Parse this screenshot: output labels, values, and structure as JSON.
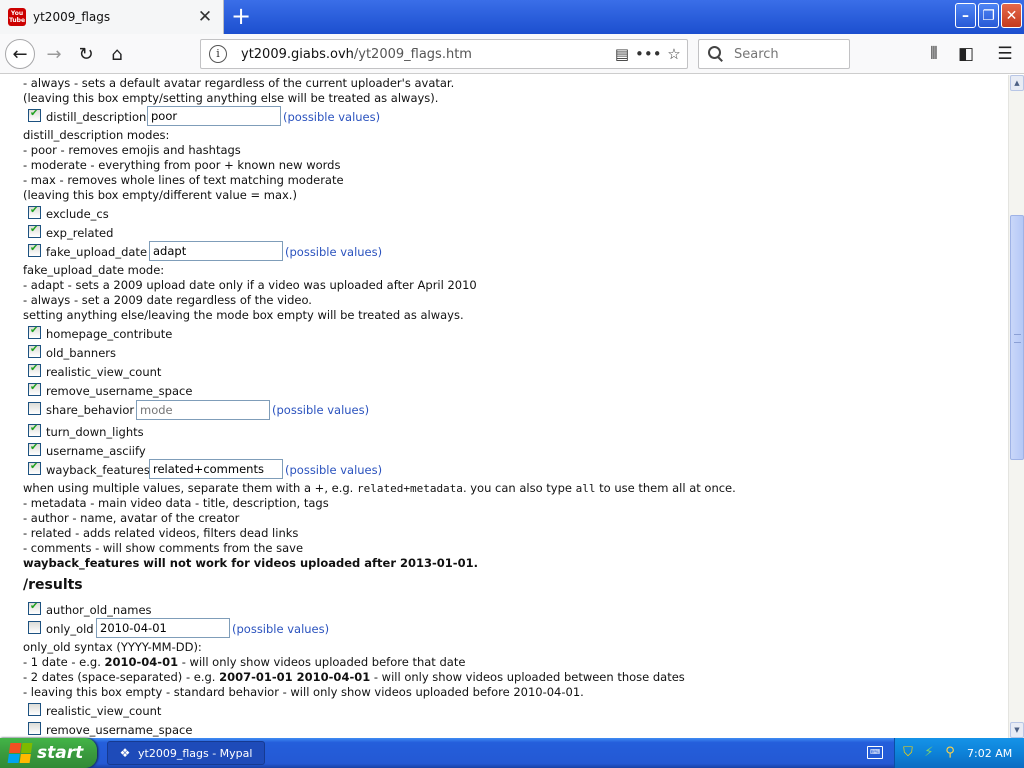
{
  "browser": {
    "tab_title": "yt2009_flags",
    "tab_favicon_text": "You Tube",
    "url_host": "yt2009.giabs.ovh",
    "url_path": "/yt2009_flags.htm",
    "search_placeholder": "Search"
  },
  "colors": {
    "link": "#2a52be",
    "check": "#21a121",
    "taskbar": "#245edb",
    "start": "#3a9b3e"
  },
  "content": {
    "avatar_line1": "- always - sets a default avatar regardless of the current uploader's avatar.",
    "avatar_line2": "(leaving this box empty/setting anything else will be treated as always).",
    "flags": {
      "distill_description": {
        "label": "distill_description",
        "checked": true,
        "value": "poor",
        "link": "(possible values)"
      },
      "exclude_cs": {
        "label": "exclude_cs",
        "checked": true
      },
      "exp_related": {
        "label": "exp_related",
        "checked": true
      },
      "fake_upload_date": {
        "label": "fake_upload_date",
        "checked": true,
        "value": "adapt",
        "link": "(possible values)"
      },
      "homepage_contribute": {
        "label": "homepage_contribute",
        "checked": true
      },
      "old_banners": {
        "label": "old_banners",
        "checked": true
      },
      "realistic_view_count": {
        "label": "realistic_view_count",
        "checked": true
      },
      "remove_username_space": {
        "label": "remove_username_space",
        "checked": true
      },
      "share_behavior": {
        "label": "share_behavior",
        "checked": false,
        "placeholder": "mode",
        "link": "(possible values)"
      },
      "turn_down_lights": {
        "label": "turn_down_lights",
        "checked": true
      },
      "username_asciify": {
        "label": "username_asciify",
        "checked": true
      },
      "wayback_features": {
        "label": "wayback_features",
        "checked": true,
        "value": "related+comments",
        "link": "(possible values)"
      }
    },
    "distill": {
      "heading": "distill_description modes:",
      "l1": "- poor - removes emojis and hashtags",
      "l2": "- moderate - everything from poor + known new words",
      "l3": "- max - removes whole lines of text matching moderate",
      "l4": "(leaving this box empty/different value = max.)"
    },
    "fake_date": {
      "heading": "fake_upload_date mode:",
      "l1": "- adapt - sets a 2009 upload date only if a video was uploaded after April 2010",
      "l2": "- always - set a 2009 date regardless of the video.",
      "l3": "setting anything else/leaving the mode box empty will be treated as always."
    },
    "wayback": {
      "intro_a": "when using multiple values, separate them with a +, e.g. ",
      "intro_code1": "related+metadata",
      "intro_b": ". you can also type ",
      "intro_code2": "all",
      "intro_c": " to use them all at once.",
      "l1": "- metadata - main video data - title, description, tags",
      "l2": "- author - name, avatar of the creator",
      "l3": "- related - adds related videos, filters dead links",
      "l4": "- comments - will show comments from the save",
      "warning": "wayback_features will not work for videos uploaded after 2013-01-01."
    },
    "results": {
      "heading": "/results",
      "author_old_names": {
        "label": "author_old_names",
        "checked": true
      },
      "only_old": {
        "label": "only_old",
        "checked": false,
        "value": "2010-04-01",
        "link": "(possible values)"
      },
      "syntax_heading": "only_old syntax (YYYY-MM-DD):",
      "l1_a": "- 1 date - e.g. ",
      "l1_b": "2010-04-01",
      "l1_c": " - will only show videos uploaded before that date",
      "l2_a": "- 2 dates (space-separated) - e.g. ",
      "l2_b": "2007-01-01 2010-04-01",
      "l2_c": " - will only show videos uploaded between those dates",
      "l3": "- leaving this box empty - standard behavior - will only show videos uploaded before 2010-04-01.",
      "realistic_view_count": {
        "label": "realistic_view_count",
        "checked": false
      },
      "remove_username_space": {
        "label": "remove_username_space",
        "checked": false
      }
    }
  },
  "taskbar": {
    "start_label": "start",
    "task_label": "yt2009_flags - Mypal",
    "clock": "7:02 AM"
  }
}
